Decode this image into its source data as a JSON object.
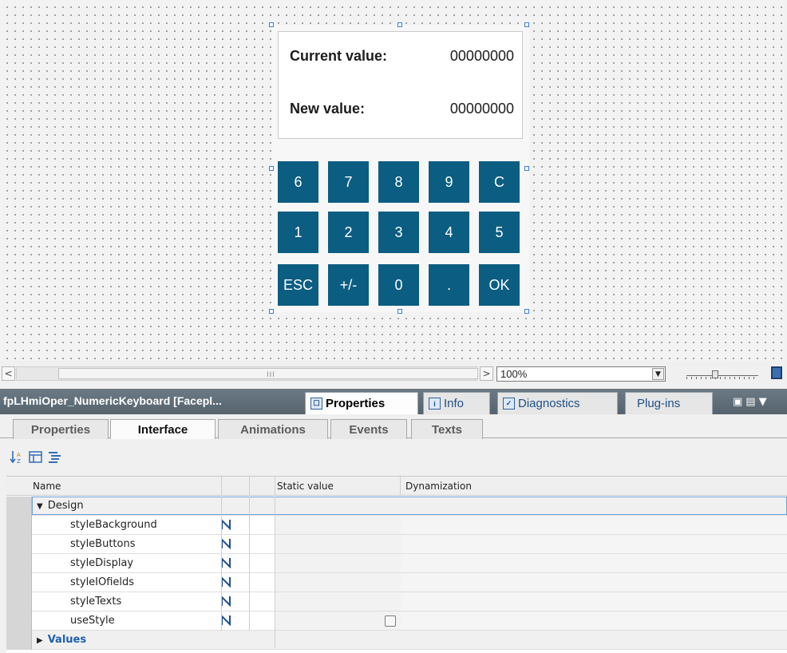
{
  "faceplate": {
    "current_label": "Current value:",
    "current_value": "00000000",
    "new_label": "New value:",
    "new_value": "00000000",
    "keys_row1": [
      "6",
      "7",
      "8",
      "9",
      "C"
    ],
    "keys_row2": [
      "1",
      "2",
      "3",
      "4",
      "5"
    ],
    "keys_row3": [
      "ESC",
      "+/-",
      "0",
      ".",
      "OK"
    ],
    "key_color": "#0b5d82"
  },
  "scrollbar": {
    "left_arrow": "<",
    "right_arrow": ">",
    "grip": "III"
  },
  "zoom": {
    "value": "100%",
    "dropdown_glyph": "▼"
  },
  "inspector": {
    "title": "fpLHmiOper_NumericKeyboard [Facepl...",
    "tabs": [
      "Properties",
      "Info",
      "Diagnostics",
      "Plug-ins"
    ],
    "header_color": "#5f6e78"
  },
  "subtabs": [
    "Properties",
    "Interface",
    "Animations",
    "Events",
    "Texts"
  ],
  "table": {
    "columns": [
      "Name",
      "Static value",
      "Dynamization"
    ],
    "groups": [
      {
        "name": "Design",
        "expanded": true,
        "items": [
          "styleBackground",
          "styleButtons",
          "styleDisplay",
          "styleIOfields",
          "styleTexts",
          "useStyle"
        ]
      },
      {
        "name": "Values",
        "expanded": false
      }
    ]
  }
}
